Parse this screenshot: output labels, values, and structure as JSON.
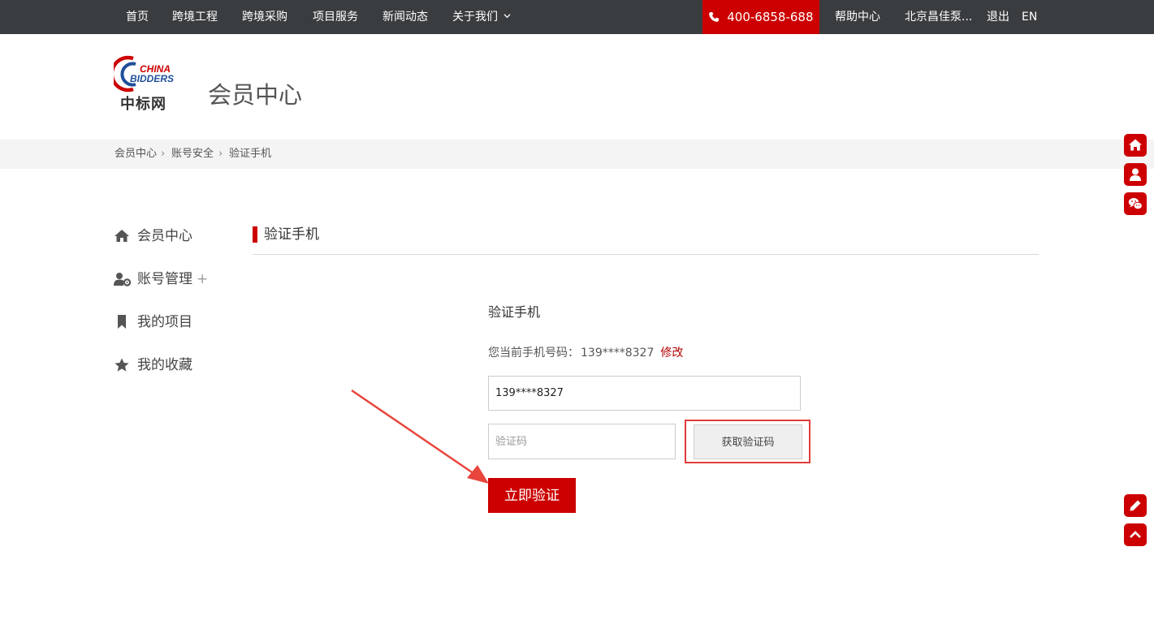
{
  "topnav": {
    "items": [
      "首页",
      "跨境工程",
      "跨境采购",
      "项目服务",
      "新闻动态",
      "关于我们"
    ],
    "phone": "400-6858-688",
    "help": "帮助中心",
    "company": "北京昌佳泵...",
    "logout": "退出",
    "lang": "EN"
  },
  "header": {
    "logo_text": "中标网",
    "logo_lines": [
      "CHINA",
      "BIDDERS"
    ],
    "title": "会员中心"
  },
  "breadcrumb": [
    "会员中心",
    "账号安全",
    "验证手机"
  ],
  "sidebar": {
    "items": [
      {
        "label": "会员中心",
        "icon": "home-icon"
      },
      {
        "label": "账号管理",
        "icon": "user-gear-icon",
        "suffix": "+"
      },
      {
        "label": "我的项目",
        "icon": "bookmark-icon"
      },
      {
        "label": "我的收藏",
        "icon": "star-icon"
      }
    ]
  },
  "section": {
    "title": "验证手机"
  },
  "form": {
    "title": "验证手机",
    "current_label": "您当前手机号码：",
    "current_value": "139****8327",
    "edit_label": "修改",
    "phone_value": "139****8327",
    "code_placeholder": "验证码",
    "get_code_label": "获取验证码",
    "submit_label": "立即验证"
  },
  "colors": {
    "brand_red": "#cc0000",
    "nav_bg": "#3a3d40",
    "highlight": "#e23c3c"
  },
  "float_buttons": [
    "home-icon",
    "user-icon",
    "wechat-icon",
    "edit-icon",
    "chevron-up-icon"
  ]
}
